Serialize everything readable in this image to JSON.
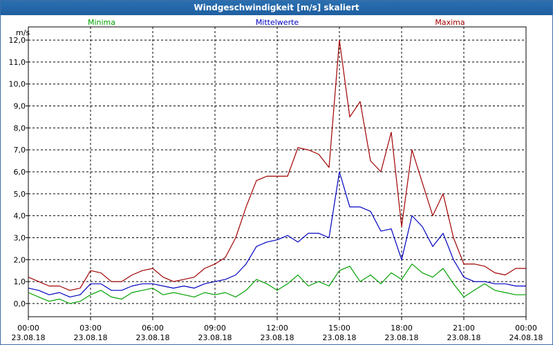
{
  "window": {
    "title": "Windgeschwindigkeit [m/s] skaliert"
  },
  "chart_data": {
    "type": "line",
    "title": "Windgeschwindigkeit [m/s] skaliert",
    "ylabel": "m/s",
    "ylim": [
      -0.6,
      12.6
    ],
    "yticks": [
      0,
      1,
      2,
      3,
      4,
      5,
      6,
      7,
      8,
      9,
      10,
      11,
      12
    ],
    "ytick_labels": [
      "0,0",
      "1,0",
      "2,0",
      "3,0",
      "4,0",
      "5,0",
      "6,0",
      "7,0",
      "8,0",
      "9,0",
      "10,0",
      "11,0",
      "12,0"
    ],
    "xlim": [
      0,
      24
    ],
    "xticks": [
      0,
      3,
      6,
      9,
      12,
      15,
      18,
      21,
      24
    ],
    "xtick_labels": [
      {
        "time": "00:00",
        "date": "23.08.18"
      },
      {
        "time": "03:00",
        "date": "23.08.18"
      },
      {
        "time": "06:00",
        "date": "23.08.18"
      },
      {
        "time": "09:00",
        "date": "23.08.18"
      },
      {
        "time": "12:00",
        "date": "23.08.18"
      },
      {
        "time": "15:00",
        "date": "23.08.18"
      },
      {
        "time": "18:00",
        "date": "23.08.18"
      },
      {
        "time": "21:00",
        "date": "23.08.18"
      },
      {
        "time": "00:00",
        "date": "24.08.18"
      }
    ],
    "grid": true,
    "legend_position": "top",
    "x_hours": [
      0,
      0.5,
      1,
      1.5,
      2,
      2.5,
      3,
      3.5,
      4,
      4.5,
      5,
      5.5,
      6,
      6.5,
      7,
      7.5,
      8,
      8.5,
      9,
      9.5,
      10,
      10.5,
      11,
      11.5,
      12,
      12.5,
      13,
      13.5,
      14,
      14.5,
      15,
      15.5,
      16,
      16.5,
      17,
      17.5,
      18,
      18.5,
      19,
      19.5,
      20,
      20.5,
      21,
      21.5,
      22,
      22.5,
      23,
      23.5,
      24
    ],
    "series": [
      {
        "name": "Minima",
        "color": "#00a000",
        "values": [
          0.5,
          0.3,
          0.1,
          0.2,
          0.0,
          0.1,
          0.4,
          0.6,
          0.3,
          0.2,
          0.5,
          0.6,
          0.7,
          0.4,
          0.5,
          0.4,
          0.3,
          0.5,
          0.4,
          0.5,
          0.3,
          0.6,
          1.1,
          0.9,
          0.6,
          0.9,
          1.3,
          0.8,
          1.0,
          0.8,
          1.5,
          1.7,
          1.0,
          1.3,
          0.9,
          1.4,
          1.1,
          1.8,
          1.4,
          1.2,
          1.6,
          0.9,
          0.3,
          0.6,
          0.9,
          0.6,
          0.5,
          0.4,
          0.4
        ]
      },
      {
        "name": "Mittelwerte",
        "color": "#0000c0",
        "values": [
          0.7,
          0.6,
          0.4,
          0.5,
          0.3,
          0.4,
          0.9,
          0.9,
          0.6,
          0.6,
          0.8,
          0.9,
          0.9,
          0.8,
          0.7,
          0.8,
          0.7,
          0.9,
          1.0,
          1.1,
          1.3,
          1.8,
          2.6,
          2.8,
          2.9,
          3.1,
          2.8,
          3.2,
          3.2,
          3.0,
          6.0,
          4.4,
          4.4,
          4.2,
          3.3,
          3.4,
          2.0,
          4.0,
          3.5,
          2.6,
          3.2,
          2.0,
          1.2,
          1.0,
          1.0,
          0.9,
          0.9,
          0.8,
          0.8
        ]
      },
      {
        "name": "Maxima",
        "color": "#a00000",
        "values": [
          1.2,
          1.0,
          0.8,
          0.8,
          0.6,
          0.7,
          1.5,
          1.4,
          1.0,
          1.0,
          1.3,
          1.5,
          1.6,
          1.2,
          1.0,
          1.1,
          1.2,
          1.6,
          1.8,
          2.1,
          3.0,
          4.4,
          5.6,
          5.8,
          5.8,
          5.8,
          7.1,
          7.0,
          6.8,
          6.2,
          12.0,
          8.5,
          9.2,
          6.5,
          6.0,
          7.8,
          3.5,
          7.0,
          5.5,
          4.0,
          5.0,
          3.0,
          1.8,
          1.8,
          1.7,
          1.4,
          1.3,
          1.6,
          1.6
        ]
      }
    ]
  }
}
